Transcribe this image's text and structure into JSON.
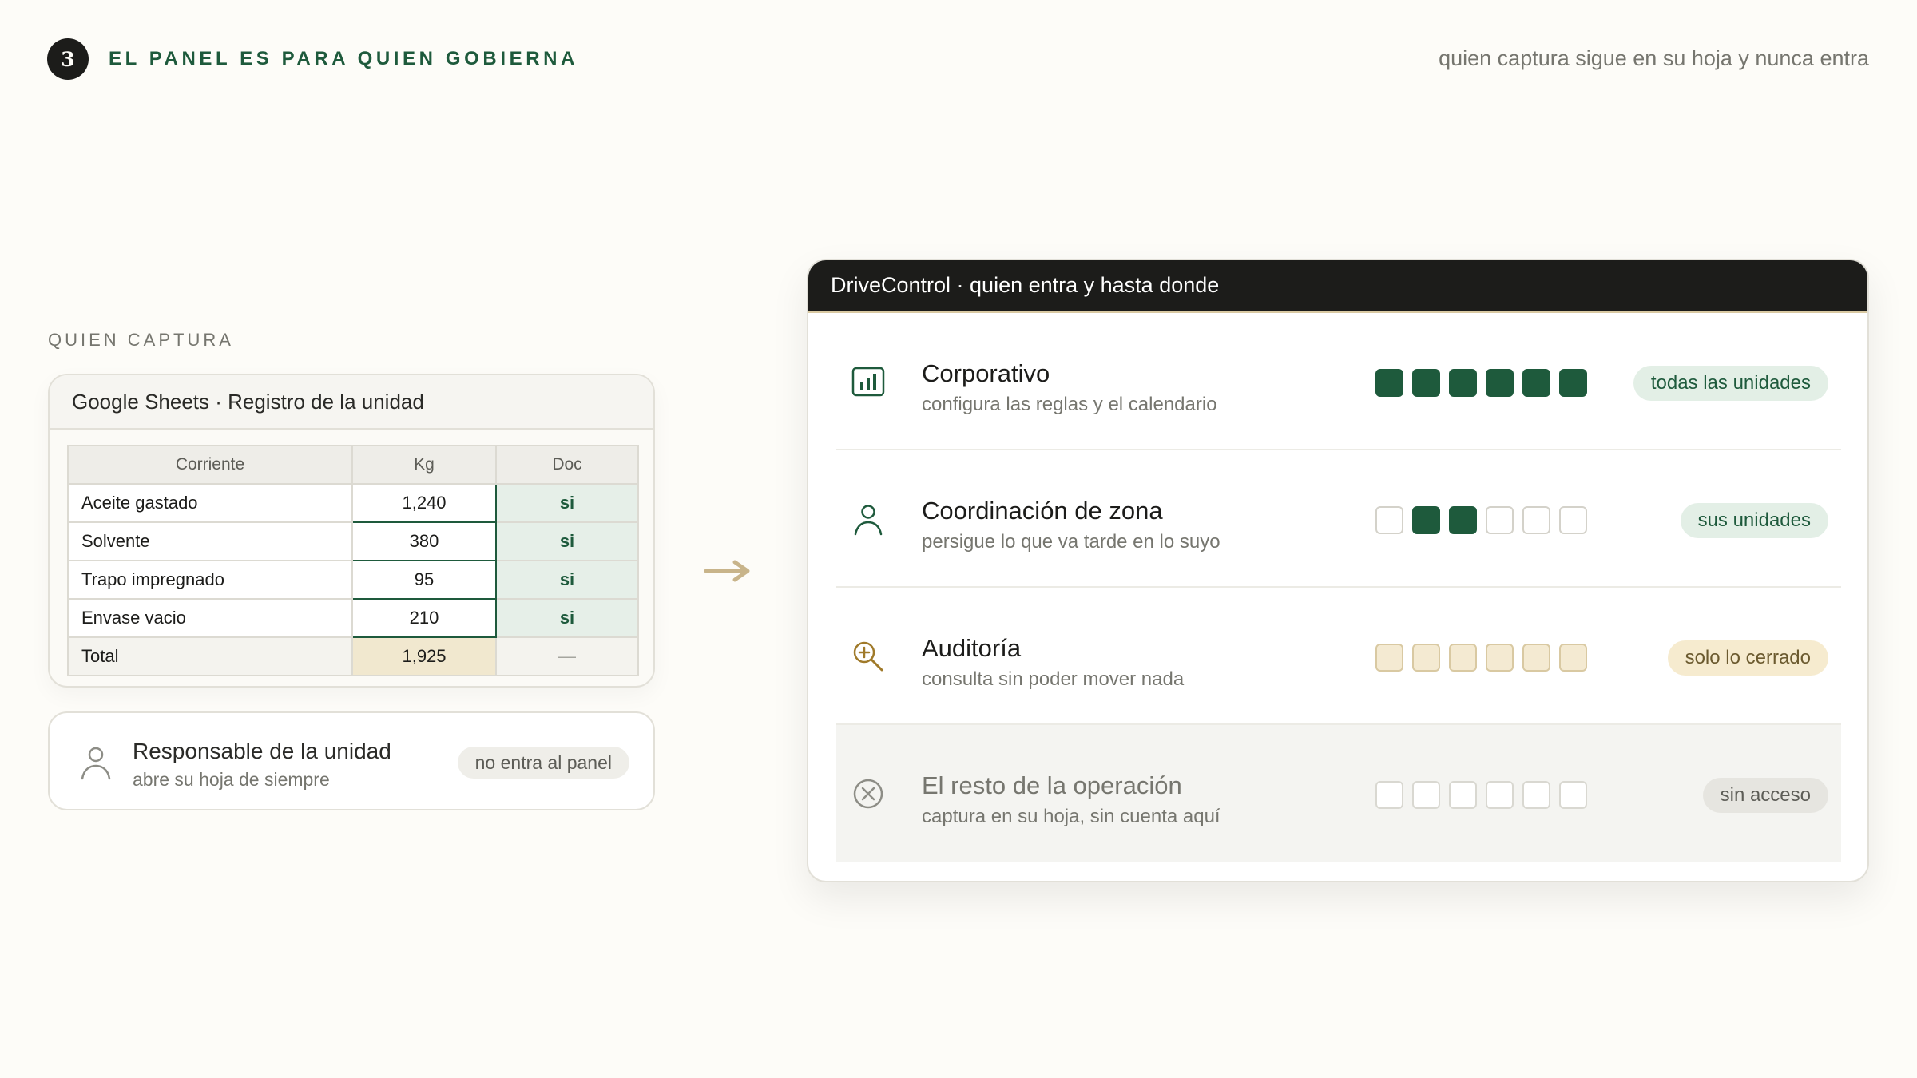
{
  "header": {
    "step_number": "3",
    "title": "EL PANEL ES PARA QUIEN GOBIERNA",
    "note": "quien captura sigue en su hoja y nunca entra"
  },
  "capture": {
    "section_label": "QUIEN CAPTURA",
    "sheet": {
      "title": "Google Sheets · Registro de la unidad",
      "columns": [
        "Corriente",
        "Kg",
        "Doc"
      ],
      "rows": [
        {
          "name": "Aceite gastado",
          "kg": "1,240",
          "doc": "si"
        },
        {
          "name": "Solvente",
          "kg": "380",
          "doc": "si"
        },
        {
          "name": "Trapo impregnado",
          "kg": "95",
          "doc": "si"
        },
        {
          "name": "Envase vacio",
          "kg": "210",
          "doc": "si"
        }
      ],
      "total": {
        "name": "Total",
        "kg": "1,925",
        "doc": "—"
      }
    },
    "responsible": {
      "icon": "person-icon",
      "title": "Responsable de la unidad",
      "subtitle": "abre su hoja de siempre",
      "pill": "no entra al panel"
    }
  },
  "arrow_icon": "arrow-right-icon",
  "panel": {
    "title": "DriveControl · quien entra y hasta donde",
    "roles": [
      {
        "icon": "bar-chart-icon",
        "title": "Corporativo",
        "subtitle": "configura las reglas y el calendario",
        "access_level": 6,
        "access_total": 6,
        "pill": "todas las unidades",
        "tone": "green"
      },
      {
        "icon": "person-icon",
        "title": "Coordinación de zona",
        "subtitle": "persigue lo que va tarde en lo suyo",
        "access_level": 2,
        "access_total": 6,
        "pill": "sus unidades",
        "tone": "green"
      },
      {
        "icon": "magnifier-plus-icon",
        "title": "Auditoría",
        "subtitle": "consulta sin poder mover nada",
        "access_level": 6,
        "access_total": 6,
        "pill": "solo lo cerrado",
        "tone": "sand"
      },
      {
        "icon": "circle-x-icon",
        "title": "El resto de la operación",
        "subtitle": "captura en su hoja, sin cuenta aquí",
        "access_level": 0,
        "access_total": 6,
        "pill": "sin acceso",
        "tone": "grey"
      }
    ]
  },
  "colors": {
    "background": "#fdfcf8",
    "accent_green": "#1e5a3c",
    "sand": "#f4ead2",
    "dark": "#1c1c1a"
  }
}
